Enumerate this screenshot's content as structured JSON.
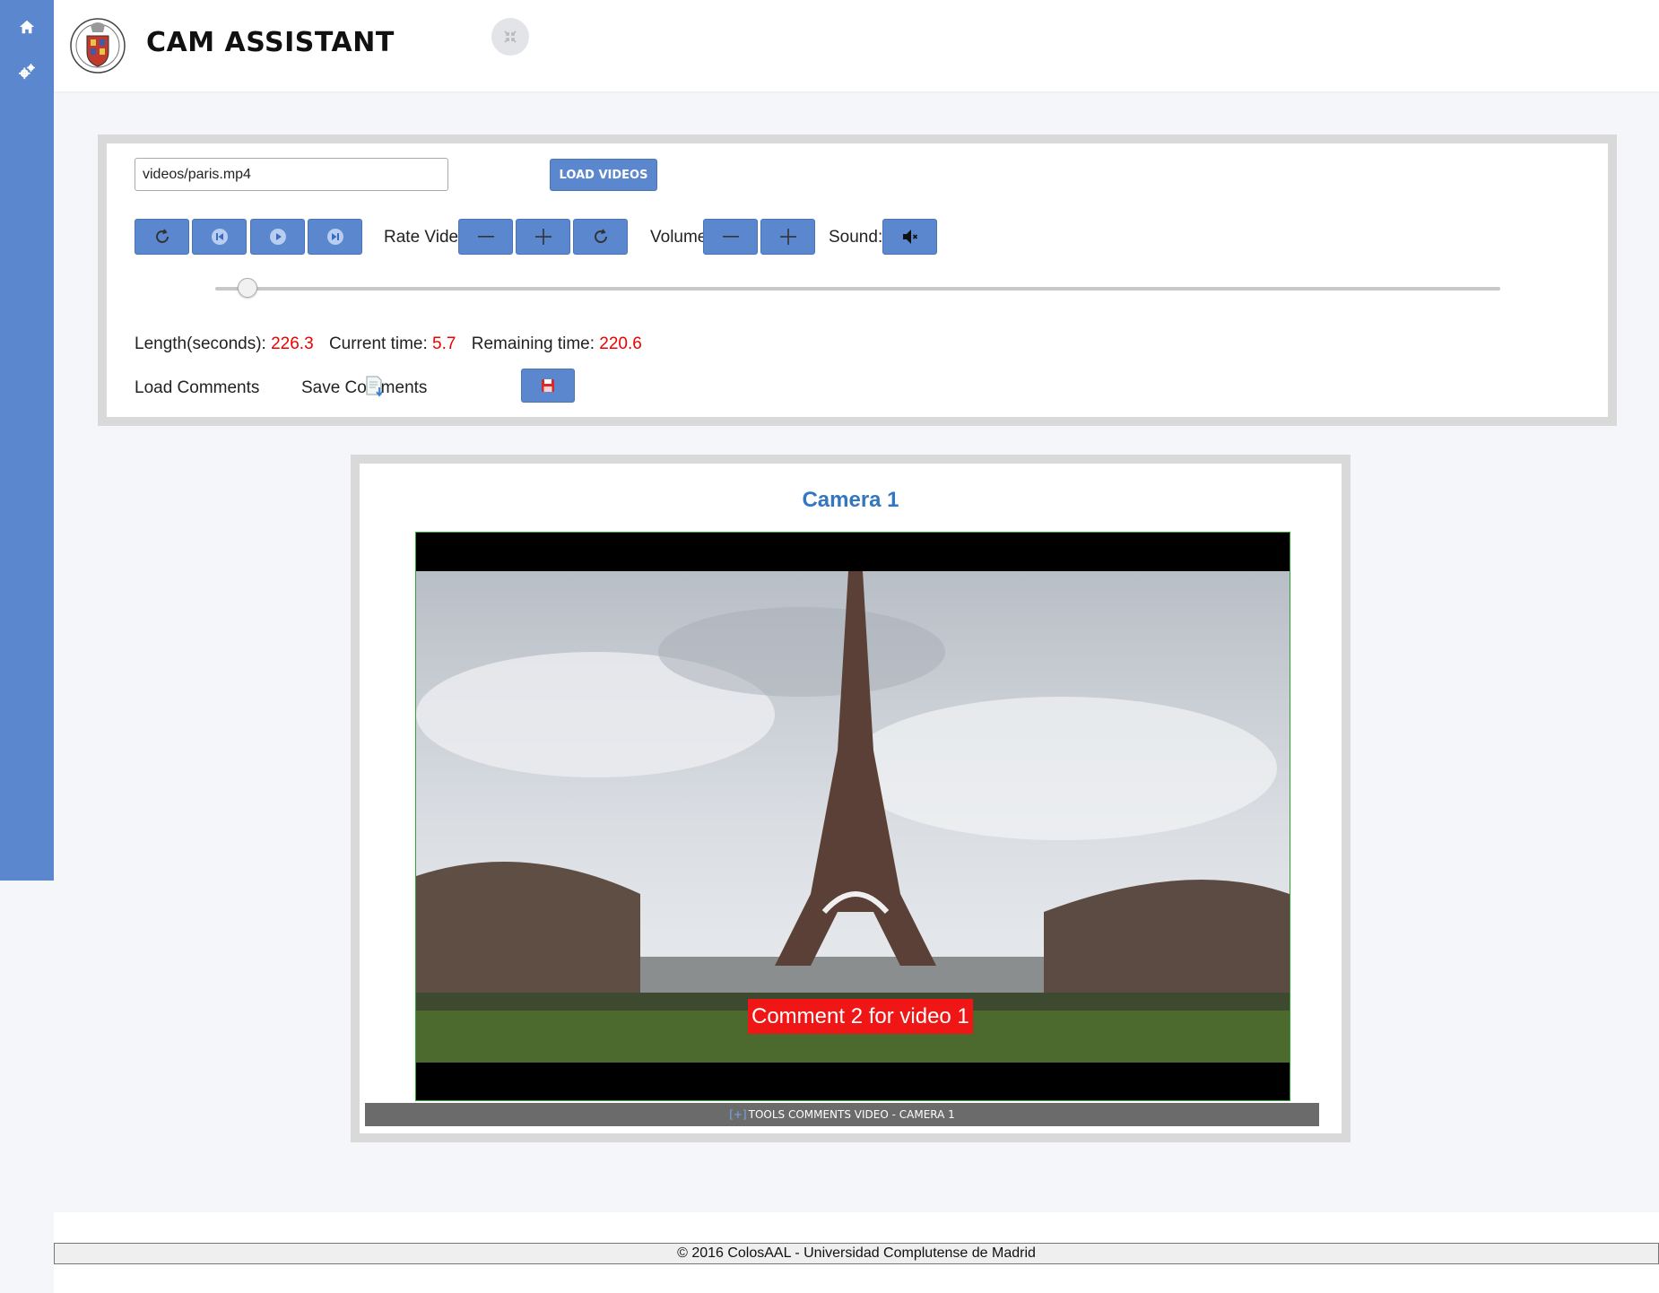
{
  "sidebar": {
    "items": [
      {
        "icon": "home-icon"
      },
      {
        "icon": "gears-icon"
      }
    ]
  },
  "header": {
    "title": "CAM ASSISTANT"
  },
  "controls": {
    "path_value": "videos/paris.mp4",
    "load_label": "LOAD VIDEOS",
    "rate_label": "Rate Video:",
    "volume_label": "Volume:",
    "sound_label": "Sound:",
    "progress_fraction": 0.025
  },
  "stats": {
    "length_label": "Length(seconds):",
    "length_value": "226.3",
    "current_label": "Current time:",
    "current_value": "5.7",
    "remaining_label": "Remaining time:",
    "remaining_value": "220.6"
  },
  "comments": {
    "load_label": "Load Comments",
    "save_label": "Save Comments"
  },
  "camera": {
    "title": "Camera 1",
    "overlay_comment": "Comment 2 for video 1",
    "tools_plus": "[+]",
    "tools_label": "TOOLS COMMENTS VIDEO - CAMERA 1"
  },
  "footer": {
    "text": "© 2016 ColosAAL - Universidad Complutense de Madrid"
  },
  "colors": {
    "accent": "#5b87cf",
    "value_red": "#e00000",
    "title_blue": "#3376c1"
  }
}
